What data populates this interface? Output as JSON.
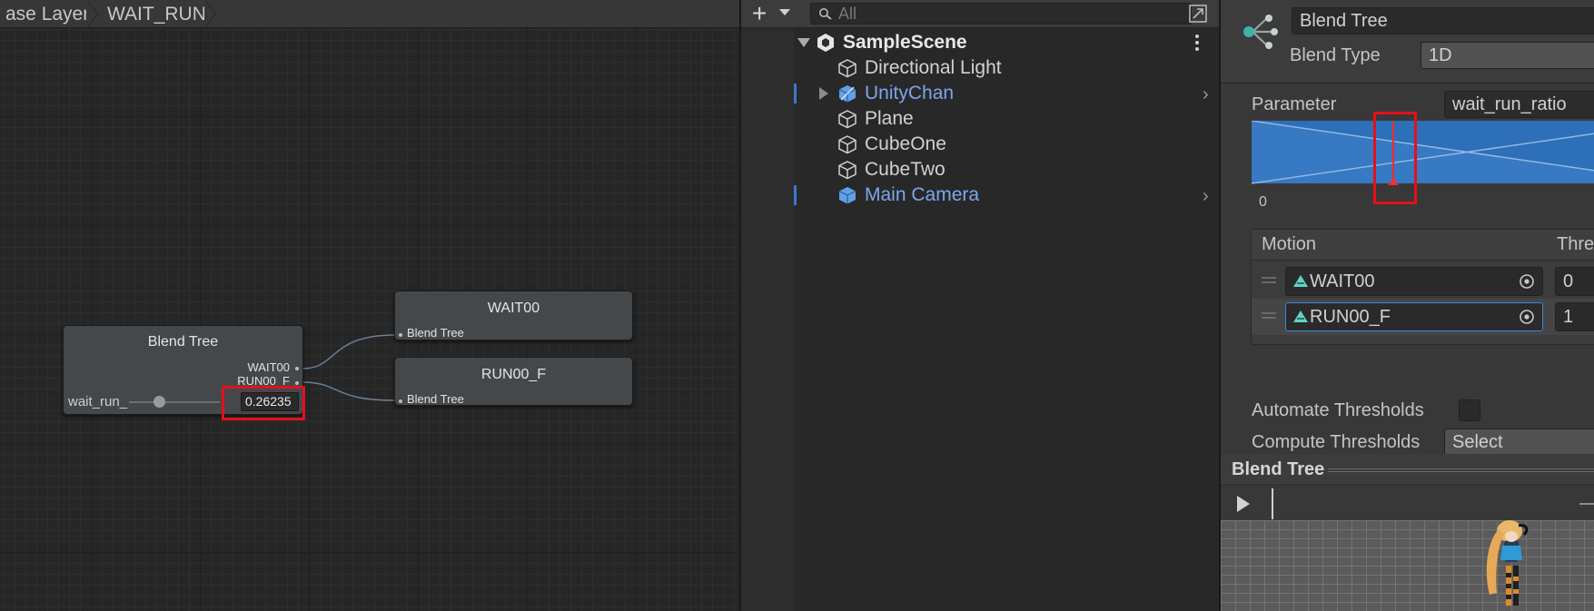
{
  "animator": {
    "breadcrumbs": [
      "ase Layer",
      "WAIT_RUN"
    ],
    "blend_node": {
      "title": "Blend Tree",
      "outputs": [
        "WAIT00",
        "RUN00_F"
      ],
      "param_label": "wait_run_",
      "param_value": "0.26235"
    },
    "child_nodes": [
      {
        "title": "WAIT00",
        "input_label": "Blend Tree"
      },
      {
        "title": "RUN00_F",
        "input_label": "Blend Tree"
      }
    ]
  },
  "hierarchy": {
    "search_placeholder": "All",
    "scene_name": "SampleScene",
    "items": [
      {
        "label": "Directional Light",
        "icon": "cube-outline-icon",
        "prefab": false
      },
      {
        "label": "UnityChan",
        "icon": "prefab-cube-icon",
        "prefab": true,
        "expandable": true
      },
      {
        "label": "Plane",
        "icon": "cube-outline-icon",
        "prefab": false
      },
      {
        "label": "CubeOne",
        "icon": "cube-outline-icon",
        "prefab": false
      },
      {
        "label": "CubeTwo",
        "icon": "cube-outline-icon",
        "prefab": false
      },
      {
        "label": "Main Camera",
        "icon": "prefab-cube-icon",
        "prefab": true
      }
    ]
  },
  "inspector": {
    "name_value": "Blend Tree",
    "blend_type_label": "Blend Type",
    "blend_type_value": "1D",
    "parameter_label": "Parameter",
    "parameter_value": "wait_run_ratio",
    "graph_min_label": "0",
    "parameter_position": 0.2623,
    "motion_header": "Motion",
    "threshold_header": "Thre",
    "motions": [
      {
        "name": "WAIT00",
        "threshold": "0"
      },
      {
        "name": "RUN00_F",
        "threshold": "1"
      }
    ],
    "automate_label": "Automate Thresholds",
    "automate_checked": false,
    "compute_label": "Compute Thresholds",
    "compute_value": "Select"
  },
  "preview": {
    "title": "Blend Tree"
  },
  "colors": {
    "highlight": "#e4101a",
    "prefab_blue": "#7ba6ee",
    "graph_fill": "#2d6fb8"
  }
}
